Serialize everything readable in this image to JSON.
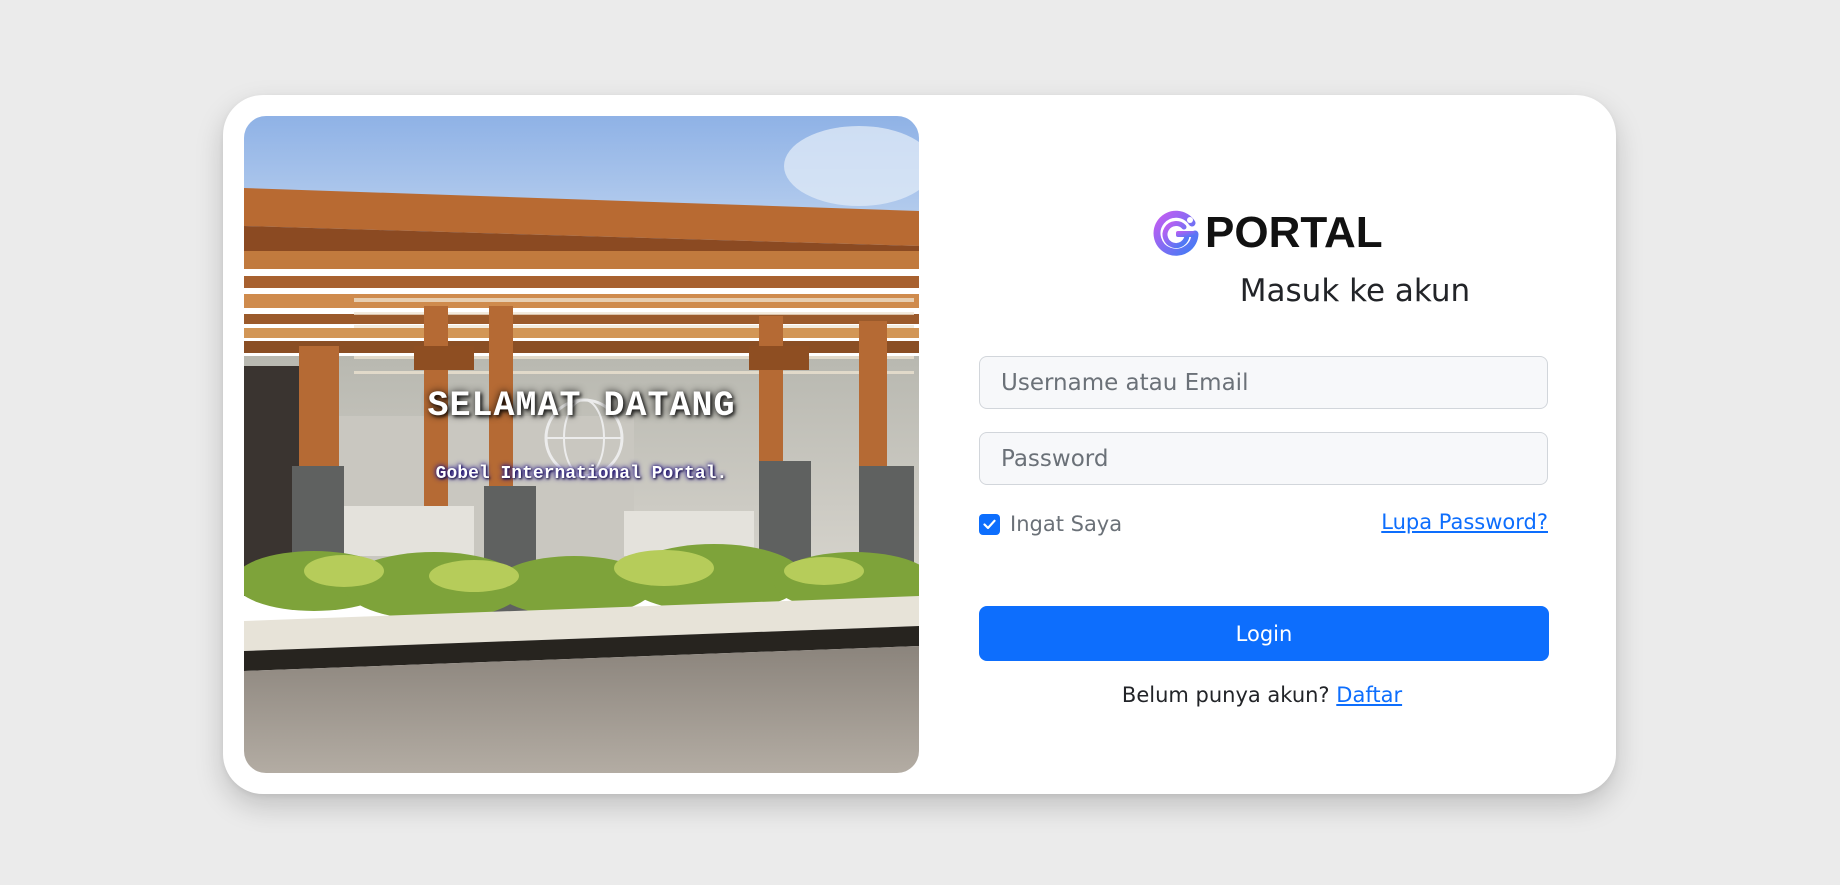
{
  "hero": {
    "title": "SELAMAT DATANG",
    "subtitle": "Gobel International Portal."
  },
  "brand": {
    "name": "PORTAL",
    "icon": "g-logo-icon"
  },
  "form": {
    "heading": "Masuk ke akun",
    "username_placeholder": "Username atau Email",
    "username_value": "",
    "password_placeholder": "Password",
    "password_value": "",
    "remember_label": "Ingat Saya",
    "remember_checked": true,
    "forgot_label": "Lupa Password?",
    "login_label": "Login",
    "register_prompt": "Belum punya akun?",
    "register_label": "Daftar"
  },
  "colors": {
    "page_bg": "#ebebeb",
    "card_bg": "#ffffff",
    "primary": "#0d6efd",
    "input_bg": "#f7f8fa",
    "input_border": "#d2d6db",
    "muted_text": "#6b7178"
  }
}
